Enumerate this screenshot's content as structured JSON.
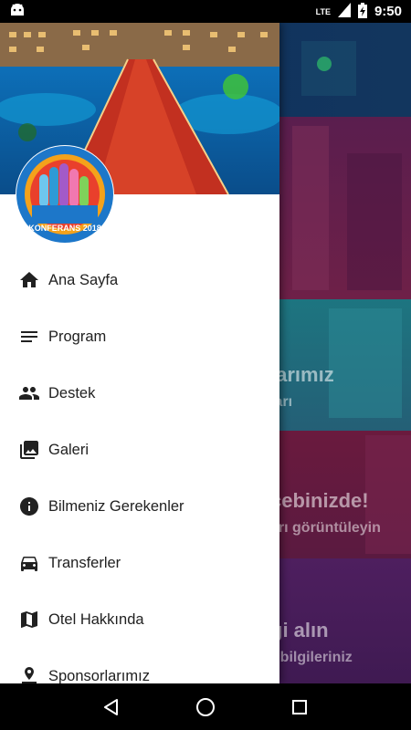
{
  "status_bar": {
    "time": "9:50",
    "network": "LTE",
    "icons": [
      "android-icon",
      "signal-icon",
      "battery-charging-icon"
    ]
  },
  "drawer": {
    "logo_text": "KONFERANS 2018",
    "menu": [
      {
        "label": "Ana Sayfa",
        "icon": "home-icon"
      },
      {
        "label": "Program",
        "icon": "notes-icon"
      },
      {
        "label": "Destek",
        "icon": "people-icon"
      },
      {
        "label": "Galeri",
        "icon": "gallery-icon"
      },
      {
        "label": "Bilmeniz Gerekenler",
        "icon": "info-icon"
      },
      {
        "label": "Transferler",
        "icon": "car-icon"
      },
      {
        "label": "Otel Hakkında",
        "icon": "map-icon"
      },
      {
        "label": "Sponsorlarımız",
        "icon": "person-pin-icon"
      }
    ]
  },
  "background": {
    "cards": [
      {
        "title": "",
        "subtitle": ""
      },
      {
        "title": "",
        "subtitle": ""
      },
      {
        "title": "larımız",
        "subtitle": "ları"
      },
      {
        "title": "cebinizde!",
        "subtitle": "arı görüntüleyin"
      },
      {
        "title": "gi alın",
        "subtitle": "r bilgileriniz"
      }
    ]
  },
  "colors": {
    "drawer_bg": "#ffffff",
    "menu_text": "#212121",
    "logo_ring": "#1d77c9",
    "overlay_purple": "#4a1e5c",
    "overlay_teal": "#1f6e78"
  },
  "nav_bar": {
    "icons": [
      "back-icon",
      "home-circle-icon",
      "recents-icon"
    ]
  }
}
